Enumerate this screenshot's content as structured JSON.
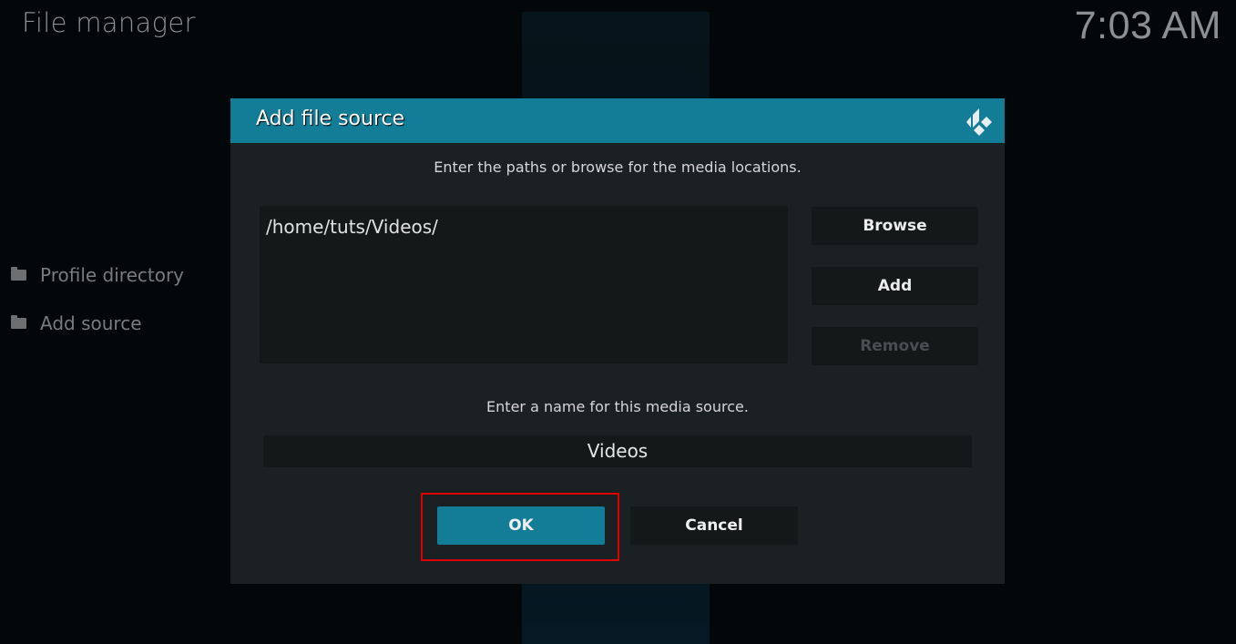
{
  "window": {
    "title": "File manager",
    "clock": "7:03 AM"
  },
  "sidebar": {
    "items": [
      {
        "label": "Profile directory",
        "icon": "folder-icon"
      },
      {
        "label": "Add source",
        "icon": "folder-icon"
      }
    ]
  },
  "dialog": {
    "title": "Add file source",
    "logo_icon": "kodi-logo-icon",
    "paths_hint": "Enter the paths or browse for the media locations.",
    "paths": [
      "/home/tuts/Videos/"
    ],
    "buttons": {
      "browse": "Browse",
      "add": "Add",
      "remove": "Remove",
      "ok": "OK",
      "cancel": "Cancel"
    },
    "name_hint": "Enter a name for this media source.",
    "name_value": "Videos"
  },
  "colors": {
    "accent": "#137d98",
    "highlight": "#e00000"
  }
}
